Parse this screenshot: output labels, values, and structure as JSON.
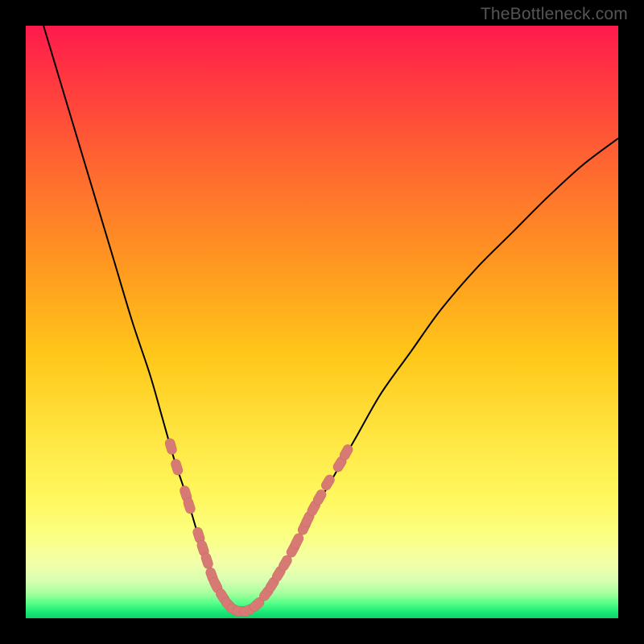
{
  "watermark": "TheBottleneck.com",
  "colors": {
    "frame": "#000000",
    "curve": "#000000",
    "marker_fill": "#d77a73",
    "marker_stroke": "#c56b64",
    "gradient_stops": [
      {
        "offset": 0.0,
        "color": "#ff1a4d"
      },
      {
        "offset": 0.1,
        "color": "#ff3b3f"
      },
      {
        "offset": 0.26,
        "color": "#ff6e2e"
      },
      {
        "offset": 0.42,
        "color": "#ff9d1f"
      },
      {
        "offset": 0.56,
        "color": "#ffc81a"
      },
      {
        "offset": 0.7,
        "color": "#ffe743"
      },
      {
        "offset": 0.8,
        "color": "#fff85f"
      },
      {
        "offset": 0.86,
        "color": "#fbff82"
      },
      {
        "offset": 0.905,
        "color": "#f4ffa8"
      },
      {
        "offset": 0.935,
        "color": "#d9ffb0"
      },
      {
        "offset": 0.958,
        "color": "#a6ff9e"
      },
      {
        "offset": 0.975,
        "color": "#54ff87"
      },
      {
        "offset": 0.99,
        "color": "#17e876"
      },
      {
        "offset": 1.0,
        "color": "#0fd06b"
      }
    ]
  },
  "chart_data": {
    "type": "line",
    "title": "",
    "xlabel": "",
    "ylabel": "",
    "xlim": [
      0,
      100
    ],
    "ylim": [
      0,
      100
    ],
    "series": [
      {
        "name": "bottleneck-curve",
        "x": [
          3,
          6,
          9,
          12,
          15,
          18,
          21,
          23,
          25,
          27,
          28.5,
          30,
          31.5,
          33,
          34,
          35,
          36,
          38,
          40,
          42,
          45,
          48,
          52,
          56,
          60,
          65,
          70,
          76,
          82,
          88,
          94,
          100
        ],
        "y": [
          100,
          90,
          80,
          70,
          60,
          50,
          41,
          34,
          27,
          21,
          16,
          11,
          7,
          4.2,
          2.5,
          1.5,
          1.2,
          1.6,
          3,
          6,
          11,
          17,
          24,
          31,
          38,
          45,
          52,
          59,
          65,
          71,
          76.5,
          81
        ]
      }
    ],
    "markers": {
      "name": "highlighted-segments",
      "points": [
        {
          "x": 24.5,
          "y": 29
        },
        {
          "x": 25.5,
          "y": 25.5
        },
        {
          "x": 27.0,
          "y": 21
        },
        {
          "x": 27.6,
          "y": 19
        },
        {
          "x": 29.2,
          "y": 14
        },
        {
          "x": 29.9,
          "y": 11.8
        },
        {
          "x": 30.6,
          "y": 9.7
        },
        {
          "x": 31.4,
          "y": 7.2
        },
        {
          "x": 32.1,
          "y": 5.6
        },
        {
          "x": 33.2,
          "y": 3.7
        },
        {
          "x": 34.2,
          "y": 2.3
        },
        {
          "x": 35.3,
          "y": 1.4
        },
        {
          "x": 36.3,
          "y": 1.2
        },
        {
          "x": 37.4,
          "y": 1.3
        },
        {
          "x": 39.0,
          "y": 2.3
        },
        {
          "x": 40.6,
          "y": 4.2
        },
        {
          "x": 41.6,
          "y": 5.7
        },
        {
          "x": 42.7,
          "y": 7.5
        },
        {
          "x": 43.8,
          "y": 9.3
        },
        {
          "x": 45.1,
          "y": 11.6
        },
        {
          "x": 45.8,
          "y": 13.0
        },
        {
          "x": 47.0,
          "y": 15.4
        },
        {
          "x": 47.6,
          "y": 16.7
        },
        {
          "x": 48.6,
          "y": 18.6
        },
        {
          "x": 49.6,
          "y": 20.4
        },
        {
          "x": 51.0,
          "y": 22.9
        },
        {
          "x": 53.0,
          "y": 26.0
        },
        {
          "x": 54.1,
          "y": 28.0
        }
      ]
    }
  }
}
